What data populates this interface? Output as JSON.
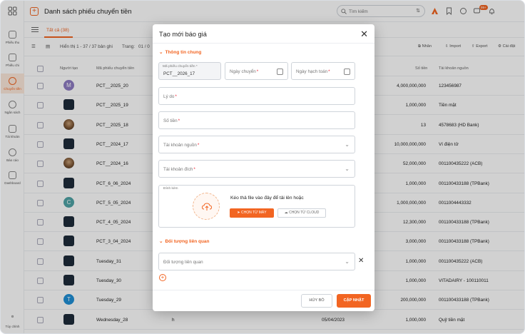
{
  "app": {
    "title": "Danh sách phiếu chuyển tiền",
    "search_placeholder": "Tìm kiếm",
    "notif_count": "99+"
  },
  "sidebar": {
    "items": [
      {
        "label": "Phiếu thu",
        "icon": "receipt-icon"
      },
      {
        "label": "Phiếu chi",
        "icon": "payment-icon"
      },
      {
        "label": "Chuyển tiền",
        "icon": "transfer-icon",
        "active": true
      },
      {
        "label": "Ngân sách",
        "icon": "budget-icon"
      },
      {
        "label": "Tài khoản",
        "icon": "wallet-icon"
      },
      {
        "label": "Báo cáo",
        "icon": "report-icon"
      },
      {
        "label": "Dashboard",
        "icon": "dashboard-icon"
      }
    ],
    "bottom_label": "Tùy chỉnh"
  },
  "tabs": {
    "all": "Tất cả (38)"
  },
  "toolbar": {
    "showing": "Hiển thị 1 - 37 / 37 bản ghi",
    "page_label": "Trang:",
    "page_value": "01 / 0",
    "duplicate": "Nhân",
    "import": "Import",
    "export": "Export",
    "settings": "Cài đặt"
  },
  "table": {
    "headers": {
      "creator": "Người tạo",
      "code": "Mã phiếu chuyển tiền",
      "amount": "Số tiền",
      "source": "Tài khoản nguồn"
    },
    "rows": [
      {
        "avatar": "M",
        "avatar_type": "letter",
        "avatar_color": "#8e7cc3",
        "code": "PCT__2025_20",
        "extra": "",
        "date": "",
        "amount": "4,000,000,000",
        "source": "123456987"
      },
      {
        "avatar": "",
        "avatar_type": "logo",
        "code": "PCT__2025_19",
        "extra": "",
        "date": "",
        "amount": "1,000,000",
        "source": "Tiền mặt"
      },
      {
        "avatar": "",
        "avatar_type": "photo",
        "code": "PCT__2025_18",
        "extra": "",
        "date": "",
        "amount": "13",
        "source": "4578683 (HD Bank)"
      },
      {
        "avatar": "",
        "avatar_type": "logo",
        "code": "PCT__2024_17",
        "extra": "",
        "date": "",
        "amount": "10,000,000,000",
        "source": "Ví điện tử"
      },
      {
        "avatar": "",
        "avatar_type": "photo",
        "code": "PCT__2024_16",
        "extra": "",
        "date": "",
        "amount": "52,000,000",
        "source": "001100435222 (ACB)"
      },
      {
        "avatar": "",
        "avatar_type": "logo",
        "code": "PCT_6_06_2024",
        "extra": "",
        "date": "",
        "amount": "1,000,000",
        "source": "001100433188 (TPBank)"
      },
      {
        "avatar": "C",
        "avatar_type": "letter",
        "avatar_color": "#4fa3a5",
        "code": "PCT_5_05_2024",
        "extra": "",
        "date": "",
        "amount": "1,000,000,000",
        "source": "0011004443332"
      },
      {
        "avatar": "",
        "avatar_type": "logo",
        "code": "PCT_4_05_2024",
        "extra": "",
        "date": "",
        "amount": "12,300,000",
        "source": "001100433188 (TPBank)"
      },
      {
        "avatar": "",
        "avatar_type": "logo",
        "code": "PCT_3_04_2024",
        "extra": "",
        "date": "",
        "amount": "3,000,000",
        "source": "001100433188 (TPBank)"
      },
      {
        "avatar": "",
        "avatar_type": "logo",
        "code": "Tuesday_31",
        "extra": "",
        "date": "",
        "amount": "1,000,000",
        "source": "001100435222 (ACB)"
      },
      {
        "avatar": "",
        "avatar_type": "logo",
        "code": "Tuesday_30",
        "extra": "",
        "date": "",
        "amount": "1,000,000",
        "source": "VITADAIRY - 100110011"
      },
      {
        "avatar": "T",
        "avatar_type": "letter",
        "avatar_color": "#1f8fd6",
        "code": "Tuesday_29",
        "extra": "",
        "date": "",
        "amount": "200,000,000",
        "source": "001100433188 (TPBank)"
      },
      {
        "avatar": "",
        "avatar_type": "logo",
        "code": "Wednesday_28",
        "extra": "h",
        "date": "05/04/2023",
        "amount": "1,000,000",
        "source": "Quỹ tiền mặt"
      }
    ]
  },
  "modal": {
    "title": "Tạo mới báo giá",
    "section_general": "Thông tin chung",
    "code_label": "Mã phiếu chuyển tiền *",
    "code_value": "PCT__2026_17",
    "transfer_date": "Ngày chuyển",
    "accounting_date": "Ngày hạch toán",
    "reason": "Lý do",
    "amount": "Số tiền",
    "source_account": "Tài khoản nguồn",
    "target_account": "Tài khoản đích",
    "attachment_label": "Đính kèm",
    "drop_text": "Kéo thả file vào đây để tải lên hoặc",
    "from_device": "CHỌN TỪ MÁY",
    "from_cloud": "CHỌN TỪ CLOUD",
    "section_related": "Đối tượng liên quan",
    "related_placeholder": "Đối tượng liên quan",
    "cancel": "HỦY BỎ",
    "update": "CẬP NHẬT"
  },
  "colors": {
    "accent": "#f26522"
  }
}
